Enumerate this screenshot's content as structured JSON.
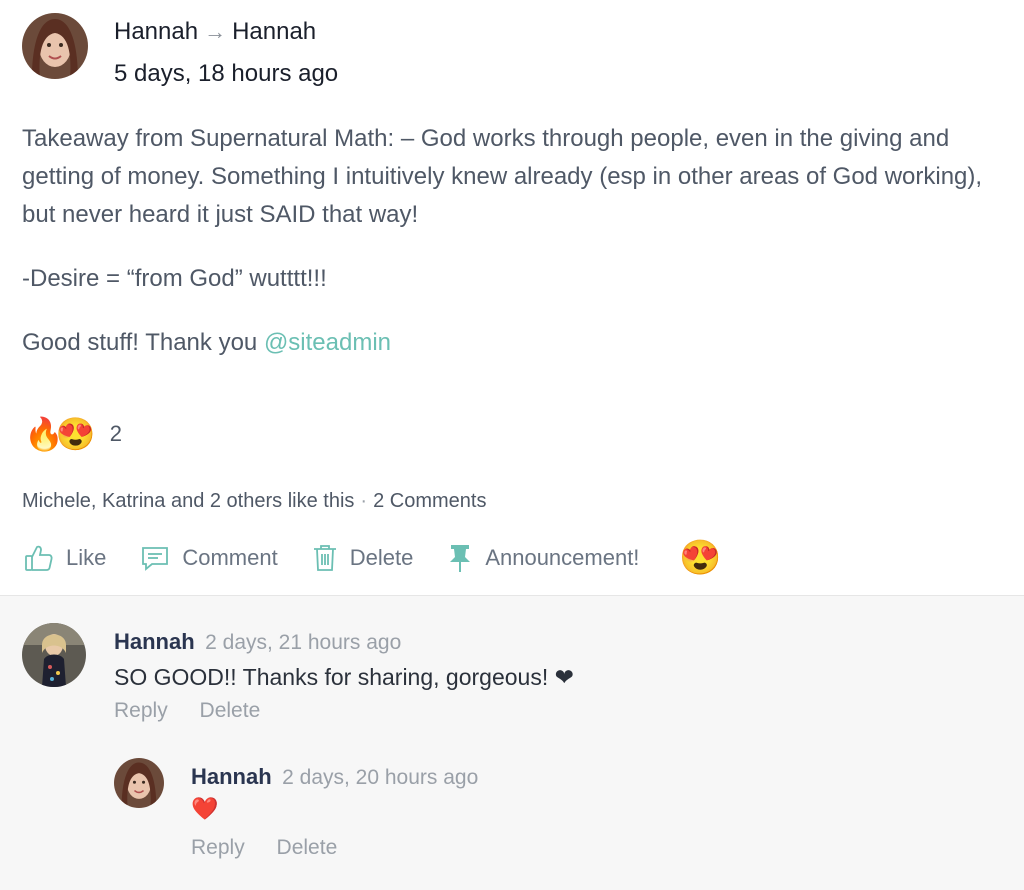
{
  "post": {
    "author": "Hannah",
    "recipient": "Hannah",
    "timestamp": "5 days, 18 hours ago",
    "paragraphs": [
      "Takeaway from Supernatural Math: – God works through people, even in the giving and getting of money. Something I intuitively knew already (esp in other areas of God working), but never heard it just SAID that way!",
      "-Desire = “from God” wutttt!!!"
    ],
    "closing_text": "Good stuff! Thank you ",
    "mention": "@siteadmin",
    "reactions": {
      "emojis": [
        "🔥",
        "😍"
      ],
      "count": "2"
    },
    "likes_text": "Michele, Katrina and 2 others like this",
    "separator": "·",
    "comments_count": "2 Comments"
  },
  "actions": {
    "like": "Like",
    "comment": "Comment",
    "delete": "Delete",
    "announcement": "Announcement!",
    "emoji": "😍"
  },
  "comments": [
    {
      "author": "Hannah",
      "time": "2 days, 21 hours ago",
      "text": "SO GOOD!! Thanks for sharing, gorgeous! ❤",
      "reply": "Reply",
      "delete": "Delete"
    },
    {
      "author": "Hannah",
      "time": "2 days, 20 hours ago",
      "text": "❤️",
      "reply": "Reply",
      "delete": "Delete"
    }
  ],
  "colors": {
    "accent": "#6bbfb3",
    "action_icon": "#6bbfb3",
    "comment_bg": "#f7f7f7"
  }
}
